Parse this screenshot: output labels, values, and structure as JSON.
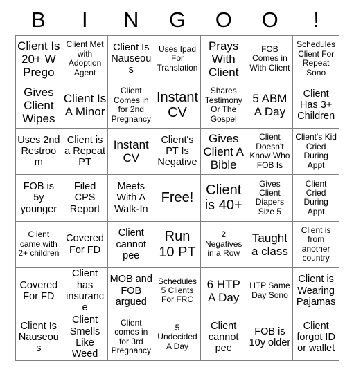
{
  "header": {
    "letters": [
      "B",
      "I",
      "N",
      "G",
      "O",
      "O",
      "!"
    ]
  },
  "card": {
    "columns": 7,
    "rows": 7,
    "border_color": "#808080",
    "text_color": "#000000",
    "background": "#ffffff",
    "free_space_label": "Free!",
    "free_space_position": {
      "row": 4,
      "col": 4
    }
  },
  "cells": [
    [
      {
        "text": "Client Is 20+ W Prego",
        "size": "lg"
      },
      {
        "text": "Client Met with Adoption Agent",
        "size": "sm"
      },
      {
        "text": "Client Is Nauseous",
        "size": "md"
      },
      {
        "text": "Uses Ipad For Translation",
        "size": "sm"
      },
      {
        "text": "Prays With Client",
        "size": "lg"
      },
      {
        "text": "FOB Comes in With Client",
        "size": "sm"
      },
      {
        "text": "Schedules Client For Repeat Sono",
        "size": "sm"
      }
    ],
    [
      {
        "text": "Gives Client Wipes",
        "size": "lg"
      },
      {
        "text": "Client Is A Minor",
        "size": "lg"
      },
      {
        "text": "Client Comes in for 2nd Pregnancy",
        "size": "sm"
      },
      {
        "text": "Instant CV",
        "size": "xl"
      },
      {
        "text": "Shares Testimony Or The Gospel",
        "size": "sm"
      },
      {
        "text": "5 ABM A Day",
        "size": "lg"
      },
      {
        "text": "Client Has 3+ Children",
        "size": "md"
      }
    ],
    [
      {
        "text": "Uses 2nd Restroom",
        "size": "md"
      },
      {
        "text": "Client is a Repeat PT",
        "size": "md"
      },
      {
        "text": "Instant CV",
        "size": "lg"
      },
      {
        "text": "Client's PT Is Negative",
        "size": "md"
      },
      {
        "text": "Gives Client A Bible",
        "size": "lg"
      },
      {
        "text": "Client Doesn't Know Who FOB Is",
        "size": "sm"
      },
      {
        "text": "Client's Kid Cried During Appt",
        "size": "sm"
      }
    ],
    [
      {
        "text": "FOB is 5y younger",
        "size": "md"
      },
      {
        "text": "Filed CPS Report",
        "size": "md"
      },
      {
        "text": "Meets With A Walk-In",
        "size": "md"
      },
      {
        "text": "Free!",
        "size": "xl"
      },
      {
        "text": "Client is 40+",
        "size": "xl"
      },
      {
        "text": "Gives Client Diapers Size 5",
        "size": "sm"
      },
      {
        "text": "Client Cried During Appt",
        "size": "sm"
      }
    ],
    [
      {
        "text": "Client came with 2+ children",
        "size": "sm"
      },
      {
        "text": "Covered For FD",
        "size": "md"
      },
      {
        "text": "Client cannot pee",
        "size": "md"
      },
      {
        "text": "Run 10 PT",
        "size": "xl"
      },
      {
        "text": "2 Negatives in a Row",
        "size": "sm"
      },
      {
        "text": "Taught a class",
        "size": "lg"
      },
      {
        "text": "Client is from another country",
        "size": "sm"
      }
    ],
    [
      {
        "text": "Covered For FD",
        "size": "md"
      },
      {
        "text": "Client has insurance",
        "size": "md"
      },
      {
        "text": "MOB and FOB argued",
        "size": "md"
      },
      {
        "text": "Schedules 5 Clients For FRC",
        "size": "sm"
      },
      {
        "text": "6 HTP A Day",
        "size": "lg"
      },
      {
        "text": "HTP Same Day Sono",
        "size": "sm"
      },
      {
        "text": "Client is Wearing Pajamas",
        "size": "md"
      }
    ],
    [
      {
        "text": "Client Is Nauseous",
        "size": "md"
      },
      {
        "text": "Client Smells Like Weed",
        "size": "md"
      },
      {
        "text": "Client comes in for 3rd Pregnancy",
        "size": "sm"
      },
      {
        "text": "5 Undecided A Day",
        "size": "sm"
      },
      {
        "text": "Client cannot pee",
        "size": "md"
      },
      {
        "text": "FOB is 10y older",
        "size": "md"
      },
      {
        "text": "Client forgot ID or wallet",
        "size": "md"
      }
    ]
  ]
}
